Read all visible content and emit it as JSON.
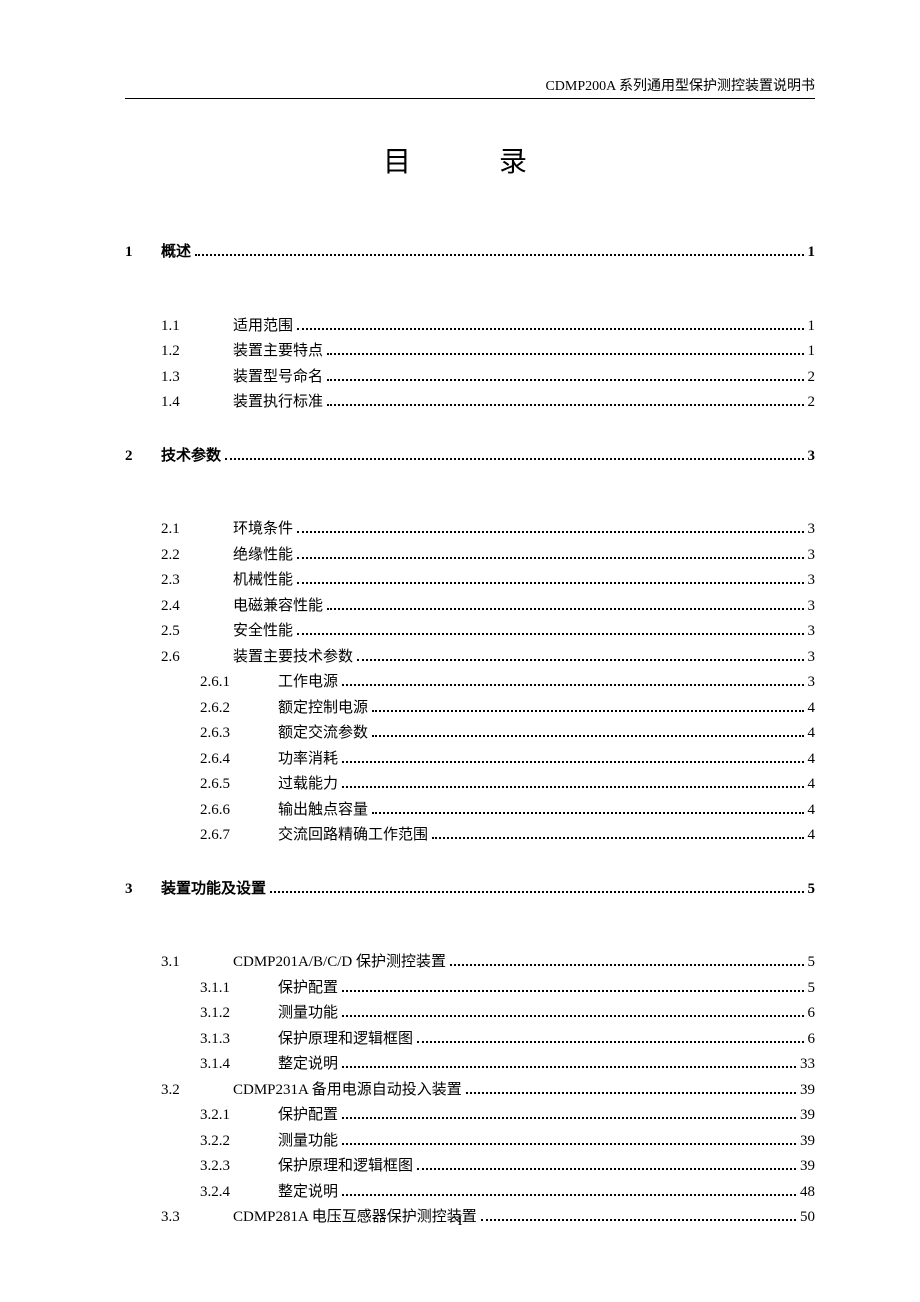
{
  "header": "CDMP200A 系列通用型保护测控装置说明书",
  "title": "目　录",
  "footer": "I",
  "toc": [
    {
      "level": 1,
      "num": "1",
      "label": "概述",
      "page": "1"
    },
    {
      "level": 2,
      "num": "1.1",
      "label": "适用范围",
      "page": "1"
    },
    {
      "level": 2,
      "num": "1.2",
      "label": "装置主要特点",
      "page": "1"
    },
    {
      "level": 2,
      "num": "1.3",
      "label": "装置型号命名",
      "page": "2"
    },
    {
      "level": 2,
      "num": "1.4",
      "label": "装置执行标准",
      "page": "2"
    },
    {
      "level": 1,
      "num": "2",
      "label": "技术参数",
      "page": "3"
    },
    {
      "level": 2,
      "num": "2.1",
      "label": "环境条件",
      "page": "3"
    },
    {
      "level": 2,
      "num": "2.2",
      "label": "绝缘性能",
      "page": "3"
    },
    {
      "level": 2,
      "num": "2.3",
      "label": "机械性能",
      "page": "3"
    },
    {
      "level": 2,
      "num": "2.4",
      "label": "电磁兼容性能",
      "page": "3"
    },
    {
      "level": 2,
      "num": "2.5",
      "label": "安全性能",
      "page": "3"
    },
    {
      "level": 2,
      "num": "2.6",
      "label": "装置主要技术参数",
      "page": "3"
    },
    {
      "level": 3,
      "num": "2.6.1",
      "label": "工作电源",
      "page": "3"
    },
    {
      "level": 3,
      "num": "2.6.2",
      "label": "额定控制电源",
      "page": "4"
    },
    {
      "level": 3,
      "num": "2.6.3",
      "label": "额定交流参数",
      "page": "4"
    },
    {
      "level": 3,
      "num": "2.6.4",
      "label": "功率消耗",
      "page": "4"
    },
    {
      "level": 3,
      "num": "2.6.5",
      "label": "过载能力",
      "page": "4"
    },
    {
      "level": 3,
      "num": "2.6.6",
      "label": "输出触点容量",
      "page": "4"
    },
    {
      "level": 3,
      "num": "2.6.7",
      "label": "交流回路精确工作范围",
      "page": "4"
    },
    {
      "level": 1,
      "num": "3",
      "label": "装置功能及设置",
      "page": "5"
    },
    {
      "level": 2,
      "num": "3.1",
      "label": "CDMP201A/B/C/D 保护测控装置",
      "page": "5"
    },
    {
      "level": 3,
      "num": "3.1.1",
      "label": "保护配置",
      "page": "5"
    },
    {
      "level": 3,
      "num": "3.1.2",
      "label": "测量功能",
      "page": "6"
    },
    {
      "level": 3,
      "num": "3.1.3",
      "label": "保护原理和逻辑框图",
      "page": "6"
    },
    {
      "level": 3,
      "num": "3.1.4",
      "label": "整定说明",
      "page": "33"
    },
    {
      "level": 2,
      "num": "3.2",
      "label": "CDMP231A 备用电源自动投入装置",
      "page": "39"
    },
    {
      "level": 3,
      "num": "3.2.1",
      "label": "保护配置",
      "page": "39"
    },
    {
      "level": 3,
      "num": "3.2.2",
      "label": "测量功能",
      "page": "39"
    },
    {
      "level": 3,
      "num": "3.2.3",
      "label": "保护原理和逻辑框图",
      "page": "39"
    },
    {
      "level": 3,
      "num": "3.2.4",
      "label": "整定说明",
      "page": "48"
    },
    {
      "level": 2,
      "num": "3.3",
      "label": "CDMP281A 电压互感器保护测控装置",
      "page": "50"
    }
  ]
}
